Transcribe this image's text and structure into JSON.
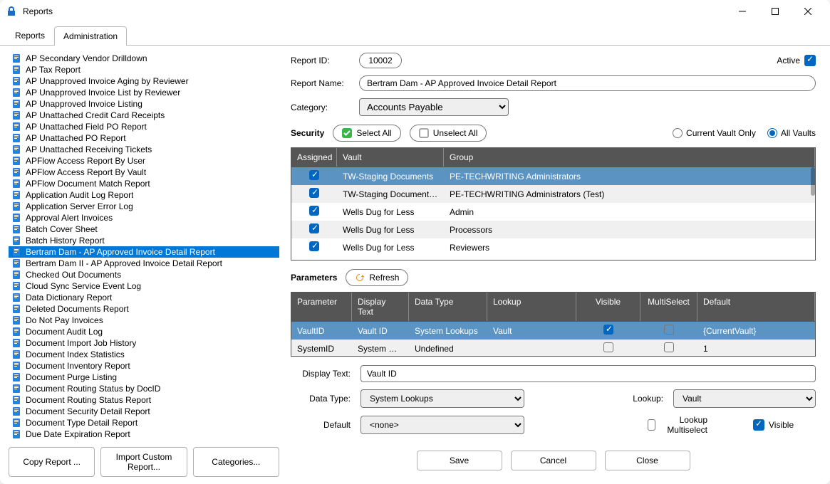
{
  "window": {
    "title": "Reports"
  },
  "tabs": {
    "reports": "Reports",
    "administration": "Administration"
  },
  "tree": {
    "selected_index": 17,
    "items": [
      "AP Secondary Vendor Drilldown",
      "AP Tax Report",
      "AP Unapproved Invoice Aging by Reviewer",
      "AP Unapproved Invoice List by Reviewer",
      "AP Unapproved Invoice Listing",
      "AP Unattached Credit Card Receipts",
      "AP Unattached Field PO Report",
      "AP Unattached PO Report",
      "AP Unattached Receiving Tickets",
      "APFlow Access Report By User",
      "APFlow Access Report By Vault",
      "APFlow Document Match Report",
      "Application Audit Log Report",
      "Application Server Error Log",
      "Approval Alert Invoices",
      "Batch Cover Sheet",
      "Batch History Report",
      "Bertram Dam - AP Approved Invoice Detail Report",
      "Bertram Dam II - AP Approved Invoice Detail Report",
      "Checked Out Documents",
      "Cloud Sync Service Event Log",
      "Data Dictionary Report",
      "Deleted Documents Report",
      "Do Not Pay Invoices",
      "Document Audit Log",
      "Document Import Job History",
      "Document Index Statistics",
      "Document Inventory Report",
      "Document Purge Listing",
      "Document Routing Status by DocID",
      "Document Routing Status Report",
      "Document Security Detail Report",
      "Document Type Detail Report",
      "Due Date Expiration Report"
    ]
  },
  "sidebar_buttons": {
    "copy": "Copy Report ...",
    "import": "Import Custom Report...",
    "categories": "Categories..."
  },
  "form": {
    "report_id_label": "Report ID:",
    "report_id": "10002",
    "report_name_label": "Report Name:",
    "report_name": "Bertram Dam - AP Approved Invoice Detail Report",
    "category_label": "Category:",
    "category": "Accounts Payable",
    "active_label": "Active",
    "active": true
  },
  "security": {
    "heading": "Security",
    "select_all": "Select All",
    "unselect_all": "Unselect All",
    "current_vault": "Current Vault Only",
    "all_vaults": "All Vaults",
    "scope": "all",
    "columns": {
      "assigned": "Assigned",
      "vault": "Vault",
      "group": "Group"
    },
    "rows": [
      {
        "assigned": true,
        "vault": "TW-Staging Documents",
        "group": "PE-TECHWRITING Administrators",
        "highlight": true
      },
      {
        "assigned": true,
        "vault": "TW-Staging Documents Test",
        "group": "PE-TECHWRITING Administrators (Test)",
        "highlight": false
      },
      {
        "assigned": true,
        "vault": "Wells Dug for Less",
        "group": "Admin",
        "highlight": false
      },
      {
        "assigned": true,
        "vault": "Wells Dug for Less",
        "group": "Processors",
        "highlight": false
      },
      {
        "assigned": true,
        "vault": "Wells Dug for Less",
        "group": "Reviewers",
        "highlight": false
      }
    ]
  },
  "parameters": {
    "heading": "Parameters",
    "refresh": "Refresh",
    "columns": {
      "parameter": "Parameter",
      "display_text": "Display Text",
      "data_type": "Data Type",
      "lookup": "Lookup",
      "visible": "Visible",
      "multiselect": "MultiSelect",
      "default": "Default"
    },
    "rows": [
      {
        "parameter": "VaultID",
        "display_text": "Vault ID",
        "data_type": "System Lookups",
        "lookup": "Vault",
        "visible": true,
        "multiselect": false,
        "default": "{CurrentVault}",
        "highlight": true
      },
      {
        "parameter": "SystemID",
        "display_text": "System Deter",
        "data_type": "Undefined",
        "lookup": "",
        "visible": false,
        "multiselect": false,
        "default": "1",
        "highlight": false
      }
    ]
  },
  "param_form": {
    "display_text_label": "Display Text:",
    "display_text": "Vault ID",
    "data_type_label": "Data Type:",
    "data_type": "System Lookups",
    "lookup_label": "Lookup:",
    "lookup": "Vault",
    "default_label": "Default",
    "default": "<none>",
    "lookup_multiselect_label": "Lookup Multiselect",
    "lookup_multiselect": false,
    "visible_label": "Visible",
    "visible": true
  },
  "footer": {
    "save": "Save",
    "cancel": "Cancel",
    "close": "Close"
  }
}
